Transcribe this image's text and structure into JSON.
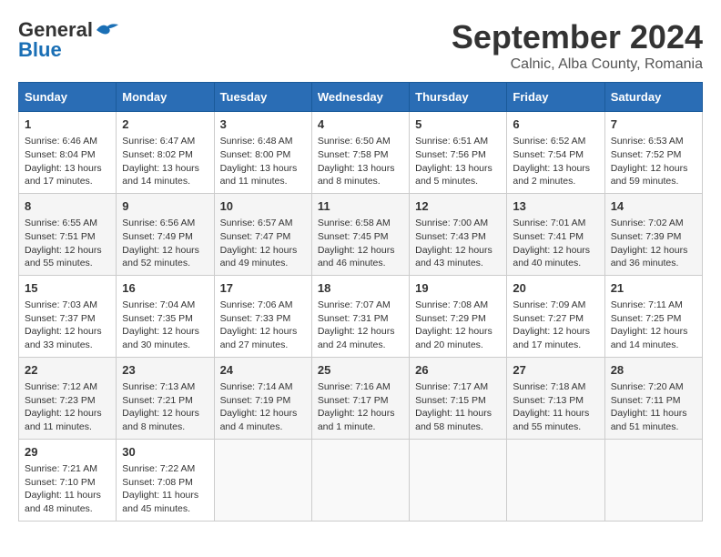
{
  "header": {
    "logo_general": "General",
    "logo_blue": "Blue",
    "month": "September 2024",
    "location": "Calnic, Alba County, Romania"
  },
  "columns": [
    "Sunday",
    "Monday",
    "Tuesday",
    "Wednesday",
    "Thursday",
    "Friday",
    "Saturday"
  ],
  "weeks": [
    [
      {
        "day": "1",
        "info": "Sunrise: 6:46 AM\nSunset: 8:04 PM\nDaylight: 13 hours and 17 minutes."
      },
      {
        "day": "2",
        "info": "Sunrise: 6:47 AM\nSunset: 8:02 PM\nDaylight: 13 hours and 14 minutes."
      },
      {
        "day": "3",
        "info": "Sunrise: 6:48 AM\nSunset: 8:00 PM\nDaylight: 13 hours and 11 minutes."
      },
      {
        "day": "4",
        "info": "Sunrise: 6:50 AM\nSunset: 7:58 PM\nDaylight: 13 hours and 8 minutes."
      },
      {
        "day": "5",
        "info": "Sunrise: 6:51 AM\nSunset: 7:56 PM\nDaylight: 13 hours and 5 minutes."
      },
      {
        "day": "6",
        "info": "Sunrise: 6:52 AM\nSunset: 7:54 PM\nDaylight: 13 hours and 2 minutes."
      },
      {
        "day": "7",
        "info": "Sunrise: 6:53 AM\nSunset: 7:52 PM\nDaylight: 12 hours and 59 minutes."
      }
    ],
    [
      {
        "day": "8",
        "info": "Sunrise: 6:55 AM\nSunset: 7:51 PM\nDaylight: 12 hours and 55 minutes."
      },
      {
        "day": "9",
        "info": "Sunrise: 6:56 AM\nSunset: 7:49 PM\nDaylight: 12 hours and 52 minutes."
      },
      {
        "day": "10",
        "info": "Sunrise: 6:57 AM\nSunset: 7:47 PM\nDaylight: 12 hours and 49 minutes."
      },
      {
        "day": "11",
        "info": "Sunrise: 6:58 AM\nSunset: 7:45 PM\nDaylight: 12 hours and 46 minutes."
      },
      {
        "day": "12",
        "info": "Sunrise: 7:00 AM\nSunset: 7:43 PM\nDaylight: 12 hours and 43 minutes."
      },
      {
        "day": "13",
        "info": "Sunrise: 7:01 AM\nSunset: 7:41 PM\nDaylight: 12 hours and 40 minutes."
      },
      {
        "day": "14",
        "info": "Sunrise: 7:02 AM\nSunset: 7:39 PM\nDaylight: 12 hours and 36 minutes."
      }
    ],
    [
      {
        "day": "15",
        "info": "Sunrise: 7:03 AM\nSunset: 7:37 PM\nDaylight: 12 hours and 33 minutes."
      },
      {
        "day": "16",
        "info": "Sunrise: 7:04 AM\nSunset: 7:35 PM\nDaylight: 12 hours and 30 minutes."
      },
      {
        "day": "17",
        "info": "Sunrise: 7:06 AM\nSunset: 7:33 PM\nDaylight: 12 hours and 27 minutes."
      },
      {
        "day": "18",
        "info": "Sunrise: 7:07 AM\nSunset: 7:31 PM\nDaylight: 12 hours and 24 minutes."
      },
      {
        "day": "19",
        "info": "Sunrise: 7:08 AM\nSunset: 7:29 PM\nDaylight: 12 hours and 20 minutes."
      },
      {
        "day": "20",
        "info": "Sunrise: 7:09 AM\nSunset: 7:27 PM\nDaylight: 12 hours and 17 minutes."
      },
      {
        "day": "21",
        "info": "Sunrise: 7:11 AM\nSunset: 7:25 PM\nDaylight: 12 hours and 14 minutes."
      }
    ],
    [
      {
        "day": "22",
        "info": "Sunrise: 7:12 AM\nSunset: 7:23 PM\nDaylight: 12 hours and 11 minutes."
      },
      {
        "day": "23",
        "info": "Sunrise: 7:13 AM\nSunset: 7:21 PM\nDaylight: 12 hours and 8 minutes."
      },
      {
        "day": "24",
        "info": "Sunrise: 7:14 AM\nSunset: 7:19 PM\nDaylight: 12 hours and 4 minutes."
      },
      {
        "day": "25",
        "info": "Sunrise: 7:16 AM\nSunset: 7:17 PM\nDaylight: 12 hours and 1 minute."
      },
      {
        "day": "26",
        "info": "Sunrise: 7:17 AM\nSunset: 7:15 PM\nDaylight: 11 hours and 58 minutes."
      },
      {
        "day": "27",
        "info": "Sunrise: 7:18 AM\nSunset: 7:13 PM\nDaylight: 11 hours and 55 minutes."
      },
      {
        "day": "28",
        "info": "Sunrise: 7:20 AM\nSunset: 7:11 PM\nDaylight: 11 hours and 51 minutes."
      }
    ],
    [
      {
        "day": "29",
        "info": "Sunrise: 7:21 AM\nSunset: 7:10 PM\nDaylight: 11 hours and 48 minutes."
      },
      {
        "day": "30",
        "info": "Sunrise: 7:22 AM\nSunset: 7:08 PM\nDaylight: 11 hours and 45 minutes."
      },
      {
        "day": "",
        "info": ""
      },
      {
        "day": "",
        "info": ""
      },
      {
        "day": "",
        "info": ""
      },
      {
        "day": "",
        "info": ""
      },
      {
        "day": "",
        "info": ""
      }
    ]
  ]
}
